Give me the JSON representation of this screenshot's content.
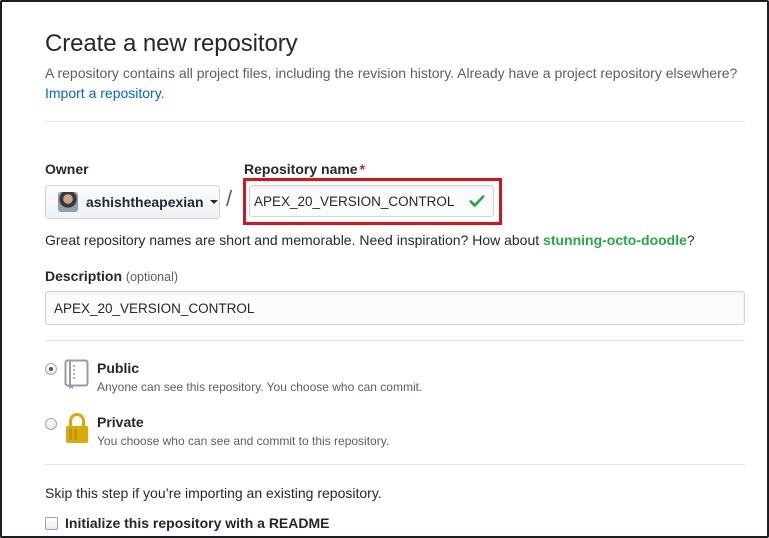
{
  "header": {
    "title": "Create a new repository",
    "subtitle": "A repository contains all project files, including the revision history. Already have a project repository elsewhere?",
    "import_link": "Import a repository."
  },
  "owner": {
    "label": "Owner",
    "value": "ashishtheapexian"
  },
  "repository_name": {
    "label": "Repository name",
    "required_marker": "*",
    "value": "APEX_20_VERSION_CONTROL",
    "valid": true
  },
  "hint": {
    "prefix": "Great repository names are short and memorable. Need inspiration? How about",
    "suggestion": "stunning-octo-doodle",
    "suffix": "?"
  },
  "description": {
    "label": "Description",
    "optional_tag": "(optional)",
    "value": "APEX_20_VERSION_CONTROL"
  },
  "visibility": {
    "selected": "public",
    "options": [
      {
        "title": "Public",
        "description": "Anyone can see this repository. You choose who can commit."
      },
      {
        "title": "Private",
        "description": "You choose who can see and commit to this repository."
      }
    ]
  },
  "init": {
    "skip_text": "Skip this step if you’re importing an existing repository.",
    "readme_label": "Initialize this repository with a README",
    "readme_checked": false
  },
  "colors": {
    "link": "#0366d6",
    "suggestion": "#28a745",
    "required": "#cb2431",
    "highlight": "#e0101b",
    "check": "#28a745"
  },
  "icons": {
    "valid": "check-icon",
    "public": "repo-book-icon",
    "private": "lock-icon",
    "owner_dropdown": "caret-down-icon"
  }
}
